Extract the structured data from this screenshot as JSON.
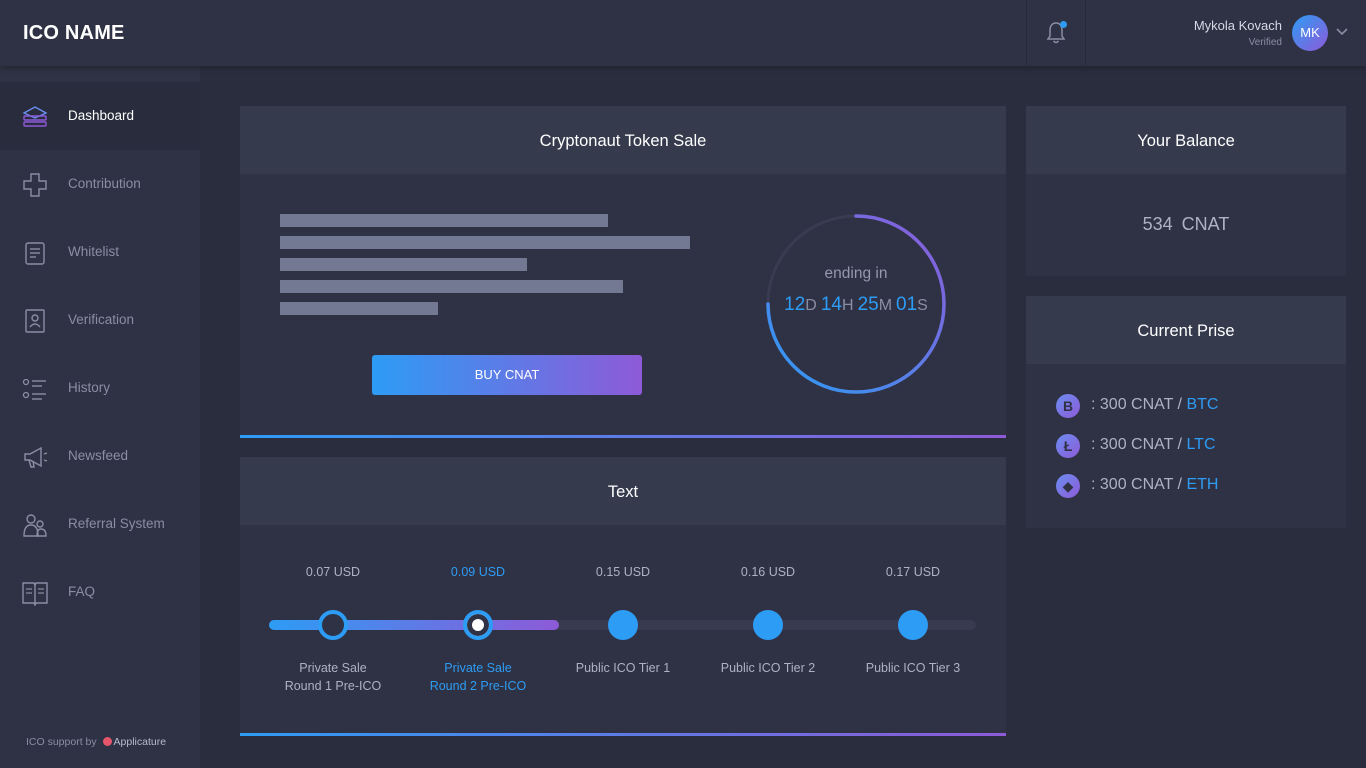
{
  "header": {
    "logo": "ICO NAME",
    "user": {
      "name": "Mykola Kovach",
      "status": "Verified",
      "initials": "MK"
    }
  },
  "sidebar": {
    "items": [
      {
        "label": "Dashboard",
        "icon": "dashboard-icon",
        "active": true
      },
      {
        "label": "Contribution",
        "icon": "contribution-icon"
      },
      {
        "label": "Whitelist",
        "icon": "whitelist-icon"
      },
      {
        "label": "Verification",
        "icon": "verification-icon"
      },
      {
        "label": "History",
        "icon": "history-icon"
      },
      {
        "label": "Newsfeed",
        "icon": "newsfeed-icon"
      },
      {
        "label": "Referral System",
        "icon": "referral-icon"
      },
      {
        "label": "FAQ",
        "icon": "faq-icon"
      }
    ],
    "support": {
      "prefix": "ICO support by",
      "brand": "Applicature"
    }
  },
  "token_sale": {
    "title": "Cryptonaut Token Sale",
    "buy_label": "BUY CNAT",
    "ending_label": "ending in",
    "countdown": {
      "days": "12",
      "days_unit": "D",
      "hours": "14",
      "hours_unit": "H",
      "minutes": "25",
      "minutes_unit": "M",
      "seconds": "01",
      "seconds_unit": "S"
    }
  },
  "balance": {
    "title": "Your Balance",
    "value": "534 CNAT"
  },
  "prices": {
    "title": "Current Prise",
    "rows": [
      {
        "glyph": "B",
        "icon": "bitcoin-icon",
        "text": ": 300 CNAT /",
        "currency": "BTC"
      },
      {
        "glyph": "Ł",
        "icon": "litecoin-icon",
        "text": ": 300  CNAT /",
        "currency": "LTC"
      },
      {
        "glyph": "◆",
        "icon": "ethereum-icon",
        "text": ": 300  CNAT /",
        "currency": "ETH"
      }
    ]
  },
  "stages": {
    "title": "Text",
    "steps": [
      {
        "price": "0.07 USD",
        "name_line1": "Private Sale",
        "name_line2": "Round 1 Pre-ICO"
      },
      {
        "price": "0.09 USD",
        "name_line1": "Private Sale",
        "name_line2": "Round 2 Pre-ICO"
      },
      {
        "price": "0.15 USD",
        "name_line1": "Public ICO Tier 1",
        "name_line2": ""
      },
      {
        "price": "0.16 USD",
        "name_line1": "Public ICO Tier 2",
        "name_line2": ""
      },
      {
        "price": "0.17 USD",
        "name_line1": "Public ICO Tier 3",
        "name_line2": ""
      }
    ]
  },
  "colors": {
    "accent_blue": "#2d9cf5",
    "accent_purple": "#8e5ad8",
    "bg": "#2a2d3e",
    "card": "#2f3244"
  }
}
